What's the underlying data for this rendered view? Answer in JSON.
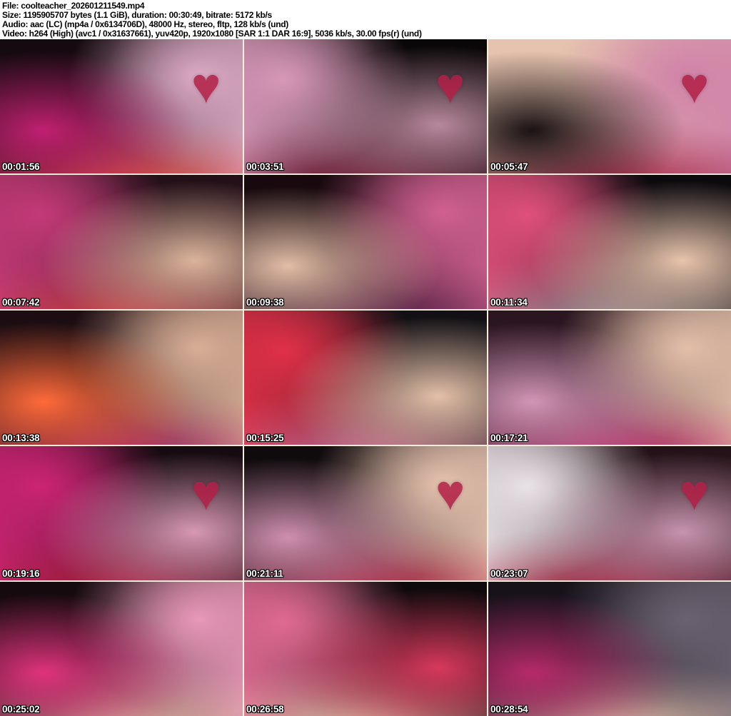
{
  "header": {
    "lines": [
      "File: coolteacher_202601211549.mp4",
      "Size: 1195905707 bytes (1.1 GiB), duration: 00:30:49, bitrate: 5172 kb/s",
      "Audio: aac (LC) (mp4a / 0x6134706D), 48000 Hz, stereo, fltp, 128 kb/s (und)",
      "Video: h264 (High) (avc1 / 0x31637661), yuv420p, 1920x1080 [SAR 1:1 DAR 16:9], 5036 kb/s, 30.00 fps(r) (und)"
    ]
  },
  "icons": {
    "heart_decor": "♥"
  },
  "colors": {
    "header_bg": "#ffffff",
    "header_text": "#000000",
    "grid_gap": "#f4eedd",
    "timestamp_text": "#ffffff",
    "timestamp_outline": "#000000",
    "heart": "#b21f46"
  },
  "thumbnails": [
    {
      "timestamp": "00:01:56",
      "heart": true,
      "palette": [
        "#150a10",
        "#c02070",
        "#dcaac4",
        "#e04840"
      ]
    },
    {
      "timestamp": "00:03:51",
      "heart": true,
      "palette": [
        "#0a0708",
        "#b8889c",
        "#d898b8",
        "#701530"
      ]
    },
    {
      "timestamp": "00:05:47",
      "heart": true,
      "palette": [
        "#e6c3ae",
        "#1a1214",
        "#d083a8",
        "#a01f40"
      ]
    },
    {
      "timestamp": "00:07:42",
      "heart": false,
      "palette": [
        "#241018",
        "#dcb49c",
        "#c43a78",
        "#d04048"
      ]
    },
    {
      "timestamp": "00:09:38",
      "heart": false,
      "palette": [
        "#17090e",
        "#e2bda6",
        "#d06090",
        "#5a2348"
      ]
    },
    {
      "timestamp": "00:11:34",
      "heart": false,
      "palette": [
        "#0d0a0e",
        "#e8c4ac",
        "#e0507c",
        "#9a8f96"
      ]
    },
    {
      "timestamp": "00:13:38",
      "heart": false,
      "palette": [
        "#1c0d12",
        "#ff6a3a",
        "#d8ae96",
        "#b02868"
      ]
    },
    {
      "timestamp": "00:15:25",
      "heart": false,
      "palette": [
        "#121014",
        "#e4c0a8",
        "#e03048",
        "#c86a94"
      ]
    },
    {
      "timestamp": "00:17:21",
      "heart": false,
      "palette": [
        "#2a1520",
        "#d295b5",
        "#e3bfa9",
        "#c02a6c"
      ]
    },
    {
      "timestamp": "00:19:16",
      "heart": true,
      "palette": [
        "#160b10",
        "#d898b4",
        "#cc2474",
        "#b01f3e"
      ]
    },
    {
      "timestamp": "00:21:11",
      "heart": true,
      "palette": [
        "#0f0a0c",
        "#cf8fae",
        "#e6c2ae",
        "#b52244"
      ]
    },
    {
      "timestamp": "00:23:07",
      "heart": true,
      "palette": [
        "#241218",
        "#c793ad",
        "#e9e2e6",
        "#a81f3c"
      ]
    },
    {
      "timestamp": "00:25:02",
      "heart": false,
      "palette": [
        "#150a0e",
        "#e0337c",
        "#e898b8",
        "#d9b09b"
      ]
    },
    {
      "timestamp": "00:26:58",
      "heart": false,
      "palette": [
        "#0e0a0c",
        "#d8385c",
        "#e06a92",
        "#e2bca4"
      ]
    },
    {
      "timestamp": "00:28:54",
      "heart": false,
      "palette": [
        "#17121a",
        "#b62a6a",
        "#6a6270",
        "#e5c0aa"
      ]
    }
  ]
}
